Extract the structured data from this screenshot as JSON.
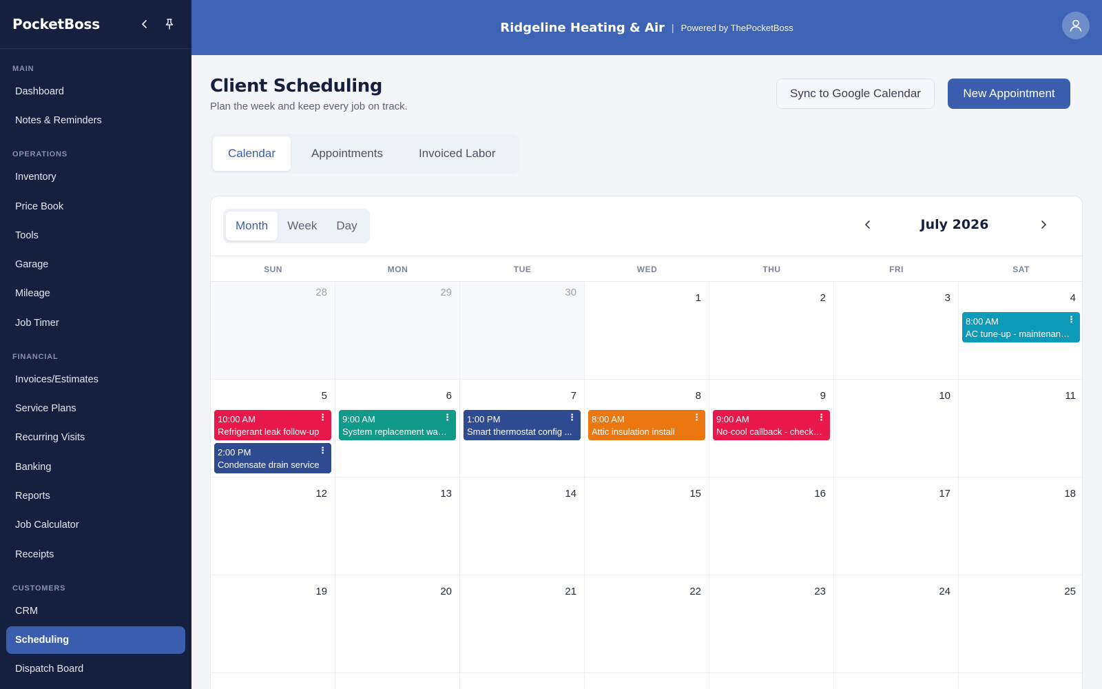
{
  "sidebar": {
    "brand": "PocketBoss",
    "sections": [
      {
        "label": "MAIN",
        "items": [
          "Dashboard",
          "Notes & Reminders"
        ]
      },
      {
        "label": "OPERATIONS",
        "items": [
          "Inventory",
          "Price Book",
          "Tools",
          "Garage",
          "Mileage",
          "Job Timer"
        ]
      },
      {
        "label": "FINANCIAL",
        "items": [
          "Invoices/Estimates",
          "Service Plans",
          "Recurring Visits",
          "Banking",
          "Reports",
          "Job Calculator",
          "Receipts"
        ]
      },
      {
        "label": "CUSTOMERS",
        "items": [
          "CRM",
          "Scheduling",
          "Dispatch Board"
        ]
      }
    ],
    "active_item": "Scheduling"
  },
  "header": {
    "company": "Ridgeline Heating & Air",
    "separator": "|",
    "powered": "Powered by ThePocketBoss"
  },
  "page": {
    "title": "Client Scheduling",
    "subtitle": "Plan the week and keep every job on track.",
    "sync_label": "Sync to Google Calendar",
    "new_label": "New Appointment"
  },
  "tabs": [
    "Calendar",
    "Appointments",
    "Invoiced Labor"
  ],
  "active_tab": "Calendar",
  "calendar": {
    "views": [
      "Month",
      "Week",
      "Day"
    ],
    "active_view": "Month",
    "month_label": "July 2026",
    "weekdays": [
      "SUN",
      "MON",
      "TUE",
      "WED",
      "THU",
      "FRI",
      "SAT"
    ],
    "weeks": [
      [
        {
          "n": "28",
          "o": true
        },
        {
          "n": "29",
          "o": true
        },
        {
          "n": "30",
          "o": true
        },
        {
          "n": "1"
        },
        {
          "n": "2"
        },
        {
          "n": "3"
        },
        {
          "n": "4",
          "events": [
            {
              "time": "8:00 AM",
              "title": "AC tune-up - maintenanc...",
              "color": "#0d99b8"
            }
          ]
        }
      ],
      [
        {
          "n": "5",
          "events": [
            {
              "time": "10:00 AM",
              "title": "Refrigerant leak follow-up",
              "color": "#e8184a"
            },
            {
              "time": "2:00 PM",
              "title": "Condensate drain service",
              "color": "#2e4a91"
            }
          ]
        },
        {
          "n": "6",
          "events": [
            {
              "time": "9:00 AM",
              "title": "System replacement walk...",
              "color": "#0f9a8a"
            }
          ]
        },
        {
          "n": "7",
          "events": [
            {
              "time": "1:00 PM",
              "title": "Smart thermostat config ...",
              "color": "#2e4a91"
            }
          ]
        },
        {
          "n": "8",
          "events": [
            {
              "time": "8:00 AM",
              "title": "Attic insulation install",
              "color": "#ec7710"
            }
          ]
        },
        {
          "n": "9",
          "events": [
            {
              "time": "9:00 AM",
              "title": "No-cool callback - check ...",
              "color": "#e8184a"
            }
          ]
        },
        {
          "n": "10"
        },
        {
          "n": "11"
        }
      ],
      [
        {
          "n": "12"
        },
        {
          "n": "13"
        },
        {
          "n": "14"
        },
        {
          "n": "15"
        },
        {
          "n": "16"
        },
        {
          "n": "17"
        },
        {
          "n": "18"
        }
      ],
      [
        {
          "n": "19"
        },
        {
          "n": "20"
        },
        {
          "n": "21"
        },
        {
          "n": "22"
        },
        {
          "n": "23"
        },
        {
          "n": "24"
        },
        {
          "n": "25"
        }
      ]
    ],
    "more_menu_glyph": "⋮"
  },
  "icons": {
    "collapse": "chevron-left-icon",
    "pin": "pin-icon",
    "user": "user-icon",
    "prev": "chevron-left-icon",
    "next": "chevron-right-icon"
  },
  "colors": {
    "sidebar_bg": "#15203e",
    "accent": "#3b5dad",
    "header_bg": "#3f63b5"
  }
}
